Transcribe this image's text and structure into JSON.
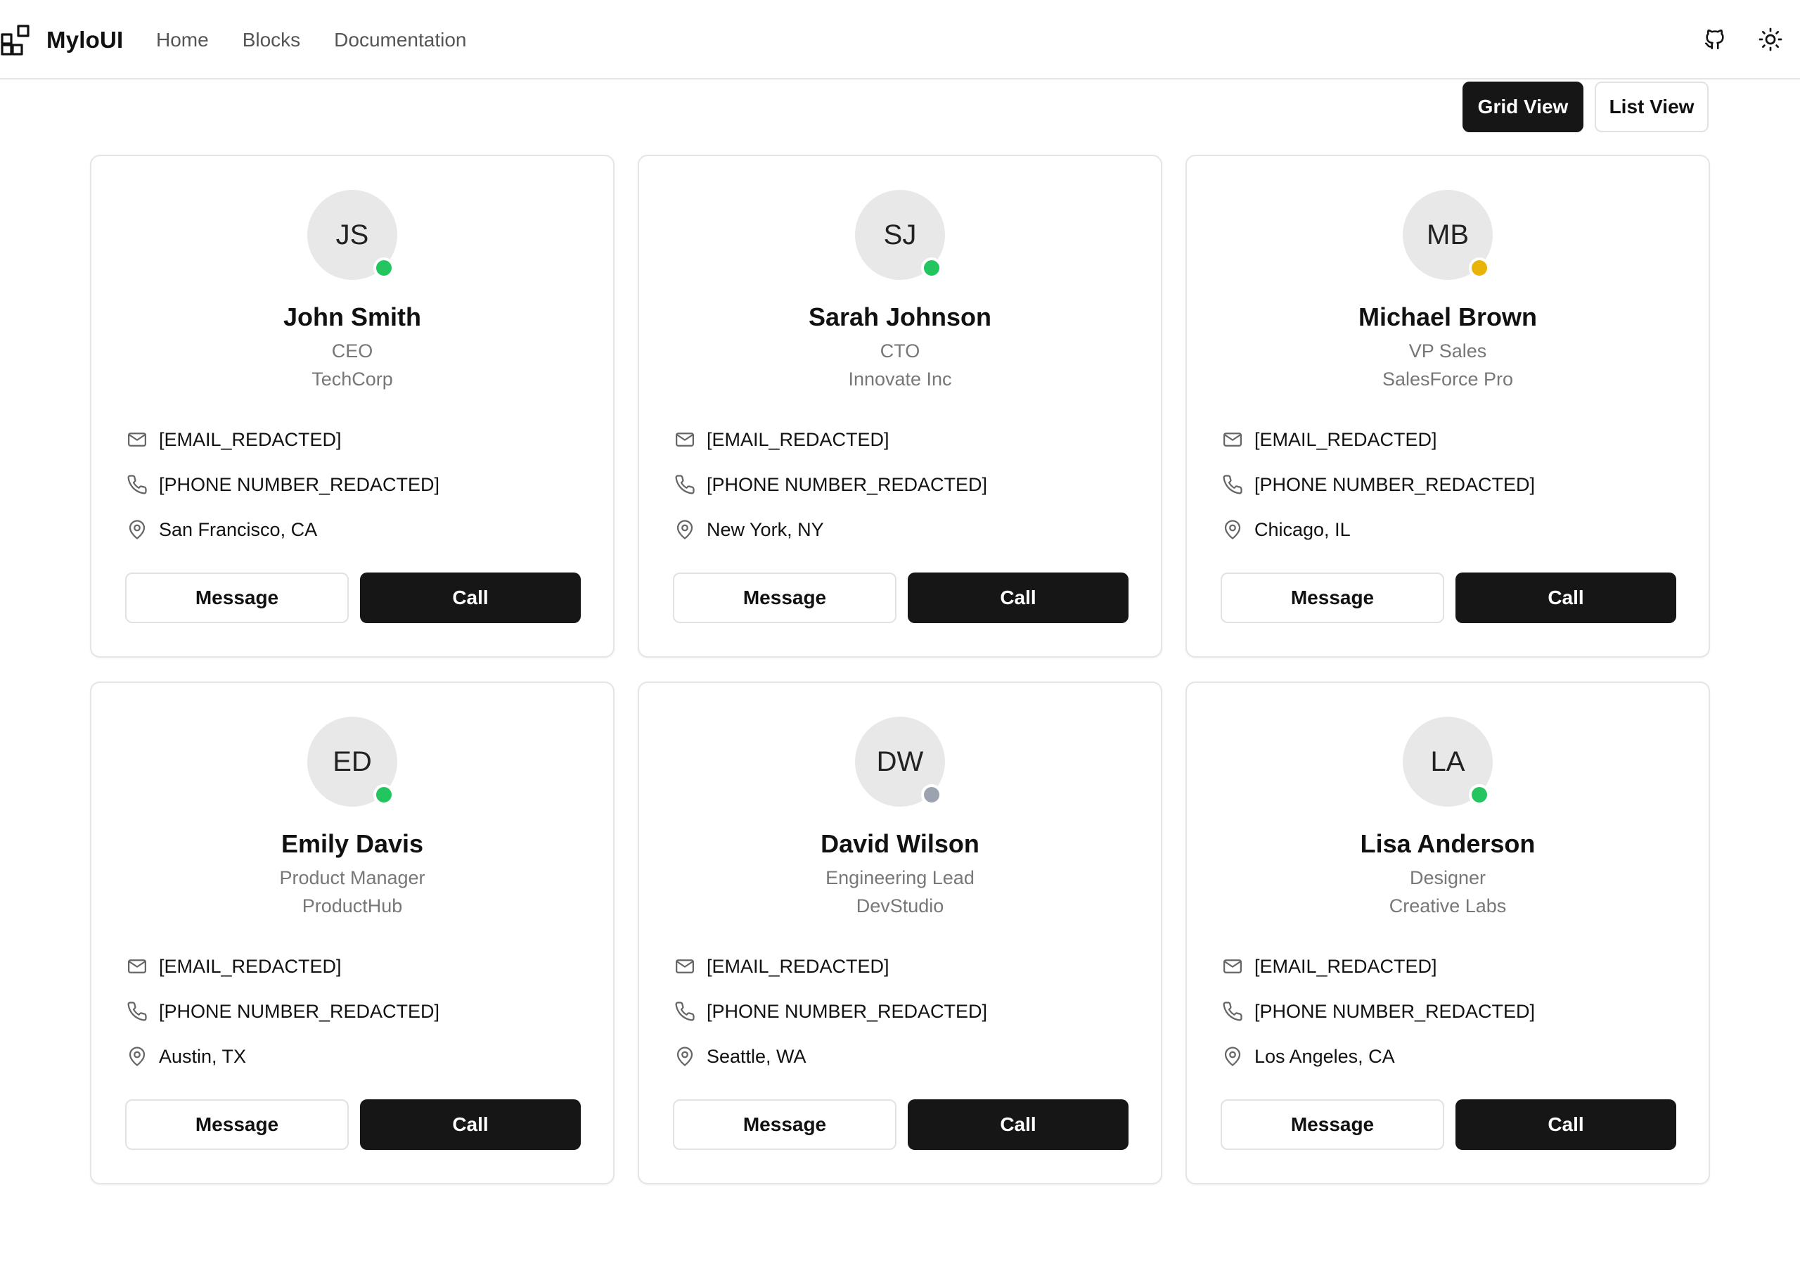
{
  "header": {
    "brand": "MyloUI",
    "nav": [
      {
        "label": "Home"
      },
      {
        "label": "Blocks"
      },
      {
        "label": "Documentation"
      }
    ],
    "icons": [
      "github-icon",
      "sun-icon"
    ]
  },
  "view_toggle": {
    "grid_label": "Grid View",
    "list_label": "List View",
    "active": "grid"
  },
  "status_colors": {
    "online": "#22c55e",
    "away": "#eab308",
    "offline": "#9ca3af"
  },
  "contacts": [
    {
      "initials": "JS",
      "name": "John Smith",
      "role": "CEO",
      "company": "TechCorp",
      "email": "[EMAIL_REDACTED]",
      "phone": "[PHONE NUMBER_REDACTED]",
      "location": "San Francisco, CA",
      "status": "online",
      "message_label": "Message",
      "call_label": "Call"
    },
    {
      "initials": "SJ",
      "name": "Sarah Johnson",
      "role": "CTO",
      "company": "Innovate Inc",
      "email": "[EMAIL_REDACTED]",
      "phone": "[PHONE NUMBER_REDACTED]",
      "location": "New York, NY",
      "status": "online",
      "message_label": "Message",
      "call_label": "Call"
    },
    {
      "initials": "MB",
      "name": "Michael Brown",
      "role": "VP Sales",
      "company": "SalesForce Pro",
      "email": "[EMAIL_REDACTED]",
      "phone": "[PHONE NUMBER_REDACTED]",
      "location": "Chicago, IL",
      "status": "away",
      "message_label": "Message",
      "call_label": "Call"
    },
    {
      "initials": "ED",
      "name": "Emily Davis",
      "role": "Product Manager",
      "company": "ProductHub",
      "email": "[EMAIL_REDACTED]",
      "phone": "[PHONE NUMBER_REDACTED]",
      "location": "Austin, TX",
      "status": "online",
      "message_label": "Message",
      "call_label": "Call"
    },
    {
      "initials": "DW",
      "name": "David Wilson",
      "role": "Engineering Lead",
      "company": "DevStudio",
      "email": "[EMAIL_REDACTED]",
      "phone": "[PHONE NUMBER_REDACTED]",
      "location": "Seattle, WA",
      "status": "offline",
      "message_label": "Message",
      "call_label": "Call"
    },
    {
      "initials": "LA",
      "name": "Lisa Anderson",
      "role": "Designer",
      "company": "Creative Labs",
      "email": "[EMAIL_REDACTED]",
      "phone": "[PHONE NUMBER_REDACTED]",
      "location": "Los Angeles, CA",
      "status": "online",
      "message_label": "Message",
      "call_label": "Call"
    }
  ]
}
